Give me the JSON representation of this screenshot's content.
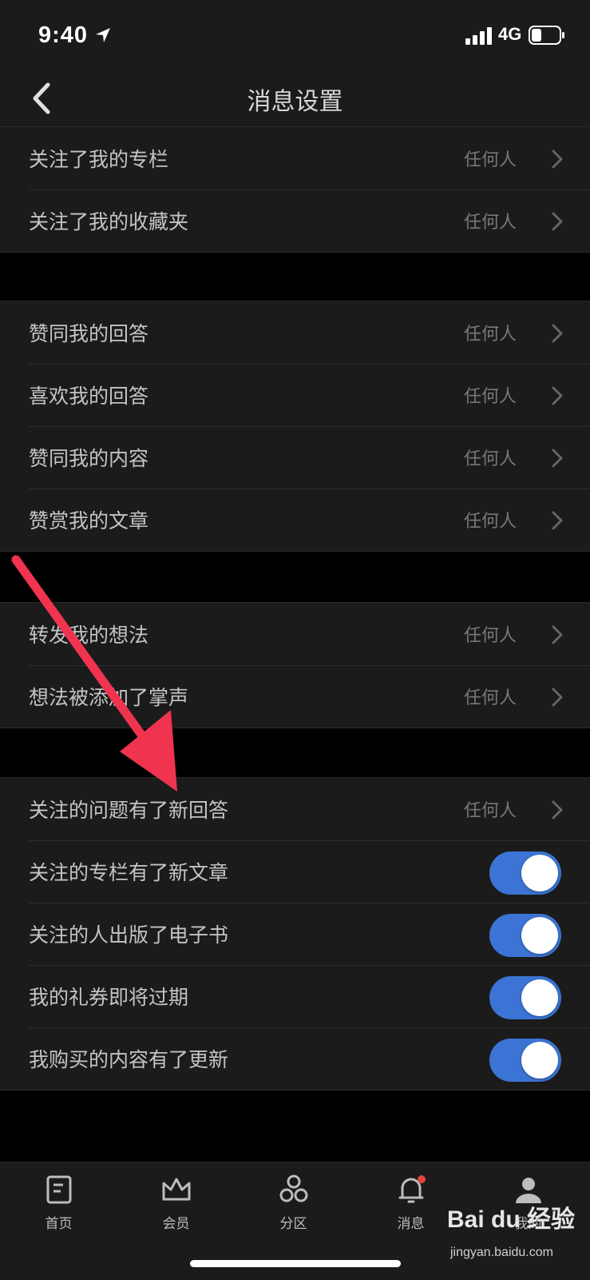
{
  "status": {
    "time": "9:40",
    "network": "4G"
  },
  "nav": {
    "title": "消息设置"
  },
  "groups": [
    {
      "rows": [
        {
          "label": "关注了我的专栏",
          "value": "任何人"
        },
        {
          "label": "关注了我的收藏夹",
          "value": "任何人"
        }
      ]
    },
    {
      "rows": [
        {
          "label": "赞同我的回答",
          "value": "任何人"
        },
        {
          "label": "喜欢我的回答",
          "value": "任何人"
        },
        {
          "label": "赞同我的内容",
          "value": "任何人"
        },
        {
          "label": "赞赏我的文章",
          "value": "任何人"
        }
      ]
    },
    {
      "rows": [
        {
          "label": "转发我的想法",
          "value": "任何人"
        },
        {
          "label": "想法被添加了掌声",
          "value": "任何人"
        }
      ]
    },
    {
      "rows": [
        {
          "label": "关注的问题有了新回答",
          "value": "任何人"
        },
        {
          "label": "关注的专栏有了新文章",
          "toggle": true
        },
        {
          "label": "关注的人出版了电子书",
          "toggle": true
        },
        {
          "label": "我的礼券即将过期",
          "toggle": true
        },
        {
          "label": "我购买的内容有了更新",
          "toggle": true
        }
      ]
    }
  ],
  "tabs": [
    {
      "label": "首页",
      "icon": "home-doc-icon"
    },
    {
      "label": "会员",
      "icon": "crown-icon"
    },
    {
      "label": "分区",
      "icon": "hexagons-icon"
    },
    {
      "label": "消息",
      "icon": "bell-icon"
    },
    {
      "label": "我的",
      "icon": "person-icon"
    }
  ],
  "watermark": {
    "text": "Bai du 经验",
    "url": "jingyan.baidu.com"
  },
  "colors": {
    "toggle_on": "#3b74d4",
    "annotation_arrow": "#f0334f",
    "notification_dot": "#e0463e"
  }
}
